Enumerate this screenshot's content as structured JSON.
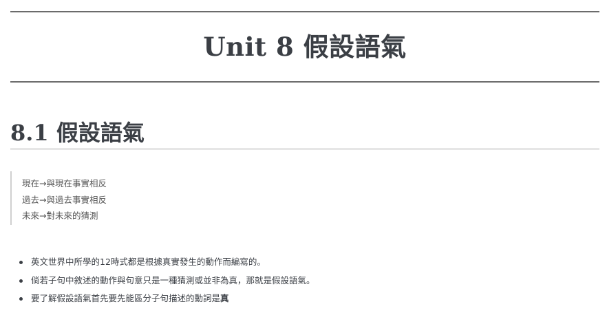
{
  "unit_title": "Unit 8 假設語氣",
  "section_title": "8.1 假設語氣",
  "quote_lines": [
    "現在→與現在事實相反",
    "過去→與過去事實相反",
    "未來→對未來的猜測"
  ],
  "bullets": [
    {
      "text": "英文世界中所學的12時式都是根據真實發生的動作而編寫的。",
      "bold_tail": ""
    },
    {
      "text": "倘若子句中敘述的動作與句意只是一種猜測或並非為真，那就是假設語氣。",
      "bold_tail": ""
    },
    {
      "text": "要了解假設語氣首先要先能區分子句描述的動詞是",
      "bold_tail": "真"
    }
  ]
}
